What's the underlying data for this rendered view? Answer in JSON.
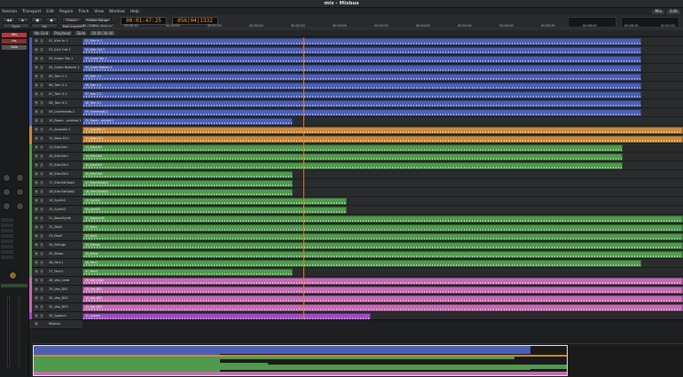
{
  "window": {
    "title": "mix - Mixbus"
  },
  "menu": {
    "items": [
      "Session",
      "Transport",
      "Edit",
      "Region",
      "Track",
      "View",
      "Window",
      "Help"
    ],
    "right_labels": [
      "Mix",
      "Edit"
    ]
  },
  "transport": {
    "play_mode": "Punch",
    "follow": "Follow Range",
    "clock_primary": "00:01:47:25",
    "clock_secondary": "056|04|1332",
    "int_label": "Int",
    "sync_label": "Sync",
    "auto_label": "Auto Return",
    "mode_label": "Non-Layered"
  },
  "ruler": {
    "ticks": [
      "00:00:00",
      "00:00:30",
      "00:01:00",
      "00:01:30",
      "00:02:00",
      "00:02:30",
      "00:03:00",
      "00:03:30",
      "00:04:00",
      "00:04:30",
      "00:05:00",
      "00:05:30",
      "00:06:00",
      "00:06:30",
      "00:07:00"
    ]
  },
  "editbar": {
    "grid": "No Grid",
    "edit_point": "Playhead",
    "zoom": "Slide",
    "clock": "00:00:30.00"
  },
  "colors": {
    "blue": "#4b5fb4",
    "orange": "#c88a3c",
    "green": "#4f9a4c",
    "pink": "#c46bb4",
    "purple": "#9c4cc0"
  },
  "left_strip": {
    "labels": [
      "Mix",
      "Ins",
      "Solo"
    ]
  },
  "tracks": [
    {
      "name": "01_Kick In 1",
      "color": "blue",
      "start": 0.0,
      "end": 0.93
    },
    {
      "name": "02_Kick Out 1",
      "color": "blue",
      "start": 0.0,
      "end": 0.93
    },
    {
      "name": "03_Snare Top 1",
      "color": "blue",
      "start": 0.0,
      "end": 0.93
    },
    {
      "name": "04_Snare Bottom 1",
      "color": "blue",
      "start": 0.0,
      "end": 0.93
    },
    {
      "name": "05_Tom 1.1",
      "color": "blue",
      "start": 0.0,
      "end": 0.93
    },
    {
      "name": "06_Tom 2.1",
      "color": "blue",
      "start": 0.0,
      "end": 0.93
    },
    {
      "name": "07_Tom 3.1",
      "color": "blue",
      "start": 0.0,
      "end": 0.93
    },
    {
      "name": "08_Tom 4.1",
      "color": "blue",
      "start": 0.0,
      "end": 0.93
    },
    {
      "name": "09_Overheads.1",
      "color": "blue",
      "start": 0.0,
      "end": 0.93
    },
    {
      "name": "10_Room - printed.1",
      "color": "blue",
      "start": 0.0,
      "end": 0.35
    },
    {
      "name": "11_Acoustic 1",
      "color": "orange",
      "start": 0.0,
      "end": 1.0
    },
    {
      "name": "12_Bass DI.1",
      "color": "orange",
      "start": 0.0,
      "end": 1.0
    },
    {
      "name": "13_ElecGtr1",
      "color": "green",
      "start": 0.0,
      "end": 0.9
    },
    {
      "name": "14_ElecGtr2",
      "color": "green",
      "start": 0.0,
      "end": 0.9
    },
    {
      "name": "15_ElecGtr3",
      "color": "green",
      "start": 0.0,
      "end": 0.9
    },
    {
      "name": "16_ElecGtr4",
      "color": "green",
      "start": 0.0,
      "end": 0.35
    },
    {
      "name": "17_ElecGtrSolo1",
      "color": "green",
      "start": 0.0,
      "end": 0.35
    },
    {
      "name": "18_ElecGtrSolo2",
      "color": "green",
      "start": 0.0,
      "end": 0.35
    },
    {
      "name": "19_Synth1",
      "color": "green",
      "start": 0.0,
      "end": 0.44
    },
    {
      "name": "20_Synth2",
      "color": "green",
      "start": 0.0,
      "end": 0.44
    },
    {
      "name": "21_BassSynth",
      "color": "green",
      "start": 0.0,
      "end": 1.0
    },
    {
      "name": "22_Pad1",
      "color": "green",
      "start": 0.0,
      "end": 1.0
    },
    {
      "name": "23_Pad2",
      "color": "green",
      "start": 0.0,
      "end": 1.0
    },
    {
      "name": "24_Strings",
      "color": "green",
      "start": 0.0,
      "end": 1.0
    },
    {
      "name": "25_Brass",
      "color": "green",
      "start": 0.0,
      "end": 1.0
    },
    {
      "name": "26_Perc1",
      "color": "green",
      "start": 0.0,
      "end": 0.93
    },
    {
      "name": "27_Perc2",
      "color": "green",
      "start": 0.0,
      "end": 0.35
    },
    {
      "name": "28_Vox_Lead",
      "color": "pink",
      "start": 0.0,
      "end": 1.0
    },
    {
      "name": "29_Vox_BV1",
      "color": "pink",
      "start": 0.0,
      "end": 1.0
    },
    {
      "name": "30_Vox_BV2",
      "color": "pink",
      "start": 0.0,
      "end": 1.0
    },
    {
      "name": "31_Vox_BV3",
      "color": "pink",
      "start": 0.0,
      "end": 1.0
    },
    {
      "name": "32_Speech",
      "color": "purple",
      "start": 0.0,
      "end": 0.48
    }
  ],
  "footer_track": {
    "name": "Mixbus"
  }
}
